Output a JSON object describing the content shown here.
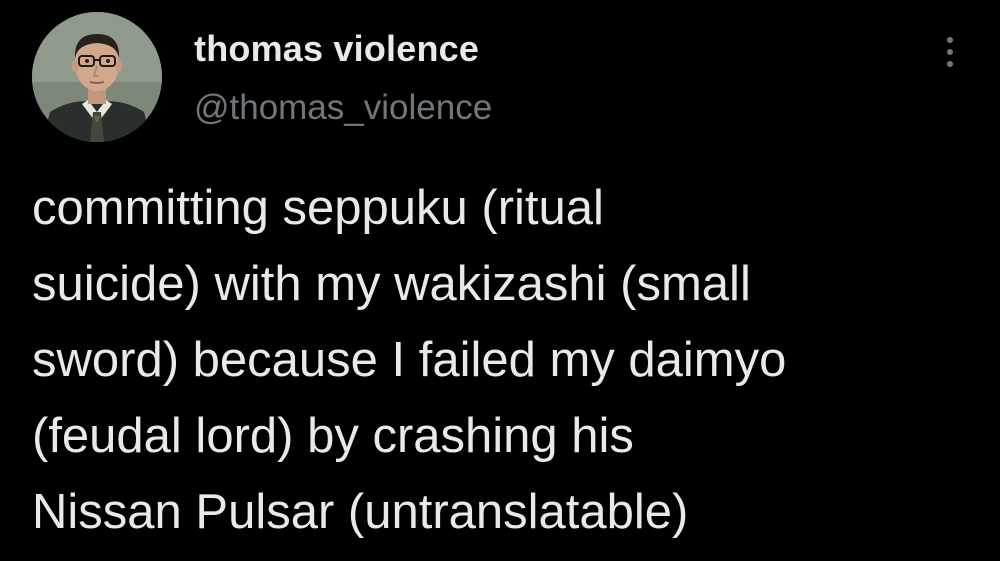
{
  "tweet": {
    "author": {
      "display_name": "thomas violence",
      "handle": "@thomas_violence"
    },
    "more_icon": "more-vertical-icon",
    "text_lines": [
      "committing seppuku (ritual",
      "suicide) with my wakizashi (small",
      "sword) because I failed my daimyo",
      "(feudal lord) by crashing his",
      "Nissan Pulsar (untranslatable)"
    ]
  },
  "colors": {
    "background": "#000000",
    "primary_text": "#e7e9ea",
    "secondary_text": "#71767b"
  }
}
